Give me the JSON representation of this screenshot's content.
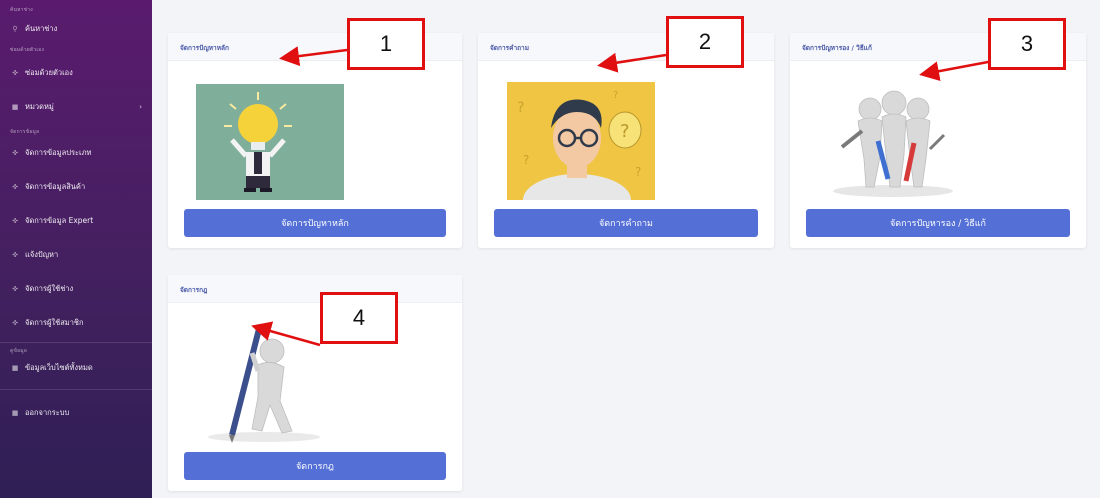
{
  "sidebar": {
    "heading_search": "ค้นหาช่าง",
    "search_label": "ค้นหาช่าง",
    "heading_self": "ซ่อมด้วยตัวเอง",
    "self_repair_label": "ซ่อมด้วยตัวเอง",
    "category_label": "หมวดหมู่",
    "heading_data": "จัดการข้อมูล",
    "items": [
      {
        "label": "จัดการข้อมูลประเภท"
      },
      {
        "label": "จัดการข้อมูลสินค้า"
      },
      {
        "label": "จัดการข้อมูล Expert"
      },
      {
        "label": "แจ้งปัญหา"
      },
      {
        "label": "จัดการผู้ใช้ช่าง"
      },
      {
        "label": "จัดการผู้ใช้สมาชิก"
      }
    ],
    "heading_info": "ดูข้อมูล",
    "website_info_label": "ข้อมูลเว็บไซต์ทั้งหมด",
    "logout_label": "ออกจากระบบ"
  },
  "cards": [
    {
      "title": "จัดการปัญหาหลัก",
      "button": "จัดการปัญหาหลัก"
    },
    {
      "title": "จัดการคำถาม",
      "button": "จัดการคำถาม"
    },
    {
      "title": "จัดการปัญหารอง / วิธีแก้",
      "button": "จัดการปัญหารอง / วิธีแก้"
    },
    {
      "title": "จัดการกฎ",
      "button": "จัดการกฎ"
    }
  ],
  "annotations": [
    "1",
    "2",
    "3",
    "4"
  ],
  "colors": {
    "accent": "#5470d6",
    "annotation": "#e01010",
    "sidebar_top": "#5a1b6e",
    "sidebar_bottom": "#2f1f55"
  }
}
